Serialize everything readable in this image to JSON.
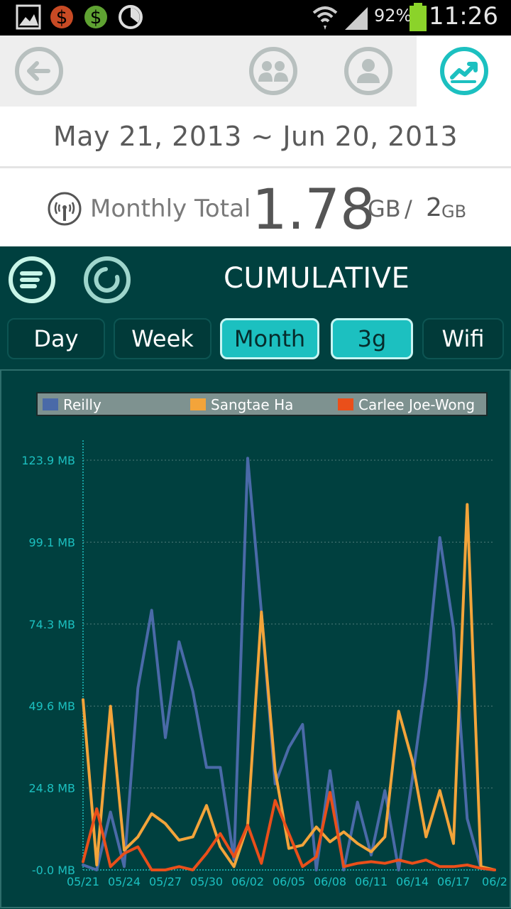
{
  "status_bar": {
    "battery_text": "92%",
    "time": "11:26",
    "icons": [
      "gallery-icon",
      "dollar-red-icon",
      "dollar-green-icon",
      "clock-icon",
      "wifi-icon",
      "signal-icon",
      "battery-icon"
    ]
  },
  "toolbar": {
    "buttons": [
      "back-icon",
      "group-icon",
      "person-icon",
      "trend-icon"
    ],
    "active": "trend-icon"
  },
  "date_range": "May 21, 2013 ~ Jun 20, 2013",
  "summary": {
    "label": "Monthly Total",
    "value": "1.78",
    "unit": "GB",
    "separator": "/",
    "limit": "2",
    "limit_unit": "GB"
  },
  "panel": {
    "title": "CUMULATIVE",
    "tabs": [
      {
        "label": "Day",
        "active": false
      },
      {
        "label": "Week",
        "active": false
      },
      {
        "label": "Month",
        "active": true
      },
      {
        "label": "3g",
        "active": true
      },
      {
        "label": "Wifi",
        "active": false
      }
    ]
  },
  "colors": {
    "panel_bg": "#00403f",
    "accent": "#1cc0c0",
    "reilly": "#4a6aa8",
    "sangtae": "#f3a43a",
    "carlee": "#ea4f1a",
    "axis": "#1cc0c0"
  },
  "chart_data": {
    "type": "line",
    "ylabel": "",
    "xlabel": "",
    "ylim": [
      0,
      123.9
    ],
    "yticks": [
      "-0.0 MB",
      "24.8 MB",
      "49.6 MB",
      "74.3 MB",
      "99.1 MB",
      "123.9 MB"
    ],
    "xticks": [
      "05/21",
      "05/24",
      "05/27",
      "05/30",
      "06/02",
      "06/05",
      "06/08",
      "06/11",
      "06/14",
      "06/17",
      "06/2"
    ],
    "x": [
      "05/21",
      "05/22",
      "05/23",
      "05/24",
      "05/25",
      "05/26",
      "05/27",
      "05/28",
      "05/29",
      "05/30",
      "05/31",
      "06/01",
      "06/02",
      "06/03",
      "06/04",
      "06/05",
      "06/06",
      "06/07",
      "06/08",
      "06/09",
      "06/10",
      "06/11",
      "06/12",
      "06/13",
      "06/14",
      "06/15",
      "06/16",
      "06/17",
      "06/18",
      "06/19",
      "06/20"
    ],
    "grid": true,
    "legend": "top",
    "series": [
      {
        "name": "Reilly",
        "values": [
          1.5,
          0,
          17.5,
          1,
          55,
          78.5,
          40,
          69,
          54,
          31,
          31,
          3,
          124.5,
          78,
          26,
          37,
          44,
          0,
          30,
          0,
          20.5,
          4.5,
          24,
          0,
          27.5,
          58,
          100.5,
          73,
          15.5,
          0.5,
          0
        ]
      },
      {
        "name": "Sangtae Ha",
        "values": [
          51.5,
          1.5,
          49.5,
          6,
          10,
          17,
          14,
          9,
          10,
          19.5,
          7,
          1,
          13.5,
          78,
          30,
          6.5,
          7.5,
          13,
          8.5,
          11.5,
          8,
          5.5,
          10,
          48,
          33,
          10,
          24,
          8,
          110.5,
          1,
          0
        ]
      },
      {
        "name": "Carlee Joe-Wong",
        "values": [
          2.5,
          18.5,
          1,
          5,
          7,
          0,
          0,
          1,
          0,
          5,
          11,
          4,
          13.5,
          2,
          21,
          11,
          1,
          4,
          23.5,
          1,
          2,
          2.5,
          2,
          3,
          2,
          3,
          1,
          1,
          1.5,
          0.5,
          0
        ]
      }
    ]
  }
}
